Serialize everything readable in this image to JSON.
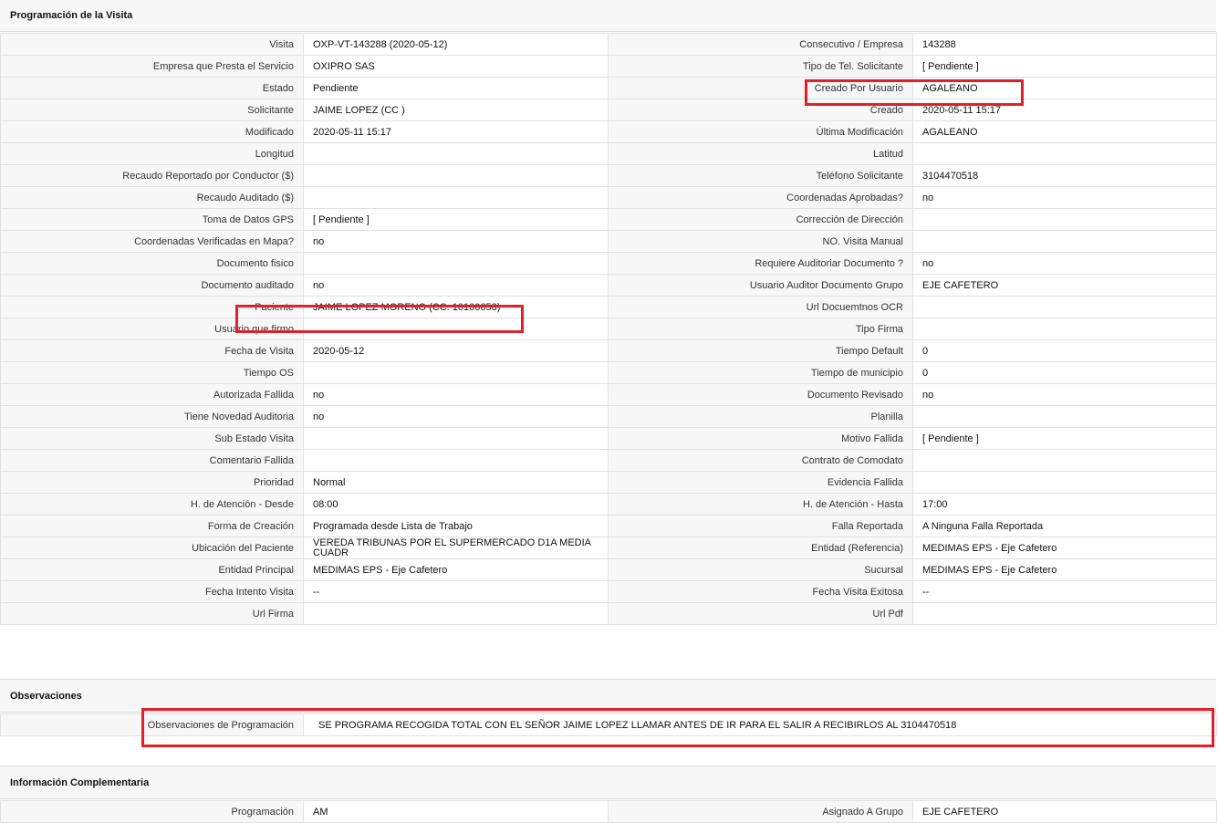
{
  "sections": {
    "programacion": "Programación de la Visita",
    "observaciones": "Observaciones",
    "complementaria": "Información Complementaria"
  },
  "programacion_rows": [
    {
      "l1": "Visita",
      "v1": "OXP-VT-143288 (2020-05-12)",
      "l2": "Consecutivo / Empresa",
      "v2": "143288"
    },
    {
      "l1": "Empresa que Presta el Servicio",
      "v1": "OXIPRO SAS",
      "l2": "Tipo de Tel. Solicitante",
      "v2": "[ Pendiente ]"
    },
    {
      "l1": "Estado",
      "v1": "Pendiente",
      "l2": "Creado Por Usuario",
      "v2": "AGALEANO"
    },
    {
      "l1": "Solicitante",
      "v1": "JAIME LOPEZ (CC )",
      "l2": "Creado",
      "v2": "2020-05-11 15:17"
    },
    {
      "l1": "Modificado",
      "v1": "2020-05-11 15:17",
      "l2": "Última Modificación",
      "v2": " AGALEANO"
    },
    {
      "l1": "Longitud",
      "v1": "",
      "l2": "Latitud",
      "v2": ""
    },
    {
      "l1": "Recaudo Reportado por Conductor ($)",
      "v1": "",
      "l2": "Teléfono Solicitante",
      "v2": "3104470518"
    },
    {
      "l1": "Recaudo Auditado ($)",
      "v1": "",
      "l2": "Coordenadas Aprobadas?",
      "v2": " no"
    },
    {
      "l1": "Toma de Datos GPS",
      "v1": "[ Pendiente ]",
      "l2": "Corrección de Dirección",
      "v2": ""
    },
    {
      "l1": "Coordenadas Verificadas en Mapa?",
      "v1": " no",
      "l2": "NO. Visita Manual",
      "v2": ""
    },
    {
      "l1": "Documento fisico",
      "v1": "",
      "l2": "Requiere Auditoriar Documento ?",
      "v2": " no"
    },
    {
      "l1": "Documento auditado",
      "v1": " no",
      "l2": "Usuario Auditor Documento Grupo",
      "v2": "EJE CAFETERO"
    },
    {
      "l1": "Paciente",
      "v1": "JAIME LOPEZ MORENO (CC: 10100658)",
      "l2": "Url Docuemtnos OCR",
      "v2": ""
    },
    {
      "l1": "Usuario que firmo",
      "v1": "",
      "l2": "Tipo Firma",
      "v2": ""
    },
    {
      "l1": "Fecha de Visita",
      "v1": " 2020-05-12",
      "l2": "Tiempo Default",
      "v2": "0"
    },
    {
      "l1": "Tiempo OS",
      "v1": "",
      "l2": "Tiempo de municipio",
      "v2": "0"
    },
    {
      "l1": "Autorizada Fallida",
      "v1": " no",
      "l2": "Documento Revisado",
      "v2": " no"
    },
    {
      "l1": "Tiene Novedad Auditoria",
      "v1": " no",
      "l2": "Planilla",
      "v2": ""
    },
    {
      "l1": "Sub Estado Visita",
      "v1": "",
      "l2": "Motivo Fallida",
      "v2": "[ Pendiente ]"
    },
    {
      "l1": "Comentario Fallida",
      "v1": "",
      "l2": "Contrato de Comodato",
      "v2": ""
    },
    {
      "l1": "Prioridad",
      "v1": "Normal",
      "l2": "Evidencia Fallida",
      "v2": ""
    },
    {
      "l1": "H. de Atención - Desde",
      "v1": "08:00",
      "l2": "H. de Atención - Hasta",
      "v2": "17:00"
    },
    {
      "l1": "Forma de Creación",
      "v1": "Programada desde Lista de Trabajo",
      "l2": "Falla Reportada",
      "v2": "A Ninguna Falla Reportada"
    },
    {
      "l1": "Ubicación del Paciente",
      "v1": "VEREDA TRIBUNAS POR EL SUPERMERCADO D1A MEDIA CUADR",
      "l2": "Entidad (Referencia)",
      "v2": "MEDIMAS EPS - Eje Cafetero"
    },
    {
      "l1": "Entidad Principal",
      "v1": "MEDIMAS EPS - Eje Cafetero",
      "l2": "Sucursal",
      "v2": "MEDIMAS EPS - Eje Cafetero"
    },
    {
      "l1": "Fecha Intento Visita",
      "v1": " --",
      "l2": "Fecha Visita Exitosa",
      "v2": " --"
    },
    {
      "l1": "Url Firma",
      "v1": "",
      "l2": "Url Pdf",
      "v2": ""
    }
  ],
  "observaciones": {
    "label": "Observaciones de Programación",
    "value": "SE PROGRAMA RECOGIDA TOTAL CON EL SEÑOR JAIME LOPEZ LLAMAR ANTES DE IR PARA EL SALIR A RECIBIRLOS AL 3104470518"
  },
  "complementaria_rows": [
    {
      "l1": "Programación",
      "v1": "AM",
      "l2": "Asignado A Grupo",
      "v2": "EJE CAFETERO"
    }
  ],
  "colors": {
    "highlight": "#e3202a",
    "label_bg": "#f7f7f7",
    "border": "#e1e1e1"
  }
}
